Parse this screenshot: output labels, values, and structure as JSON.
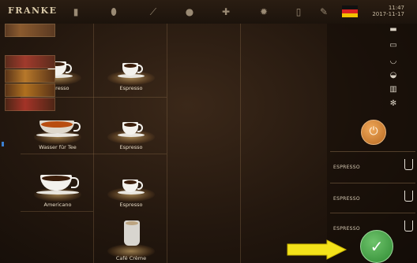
{
  "topbar": {
    "brand": "FRANKE",
    "icons": [
      "cup-icon",
      "bean-icon",
      "brush-icon",
      "drop-icon",
      "puzzle-icon",
      "gear-icon",
      "document-icon",
      "wrench-icon"
    ],
    "date": "2017-11-17",
    "time": "11:47"
  },
  "products": [
    {
      "label": "Espresso",
      "type": "espresso"
    },
    {
      "label": "Espresso",
      "type": "espresso"
    },
    {
      "label": "Wasser für Tee",
      "type": "tea"
    },
    {
      "label": "Espresso",
      "type": "espresso"
    },
    {
      "label": "Americano",
      "type": "americano"
    },
    {
      "label": "Espresso",
      "type": "espresso"
    },
    {
      "label": "Café Crème",
      "type": "creme"
    }
  ],
  "queue": [
    {
      "label": "ESPRESSO"
    },
    {
      "label": "ESPRESSO"
    },
    {
      "label": "ESPRESSO"
    }
  ],
  "colors": {
    "accent": "#d8893a",
    "confirm": "#3a9a3b",
    "arrow": "#f3e21a"
  }
}
